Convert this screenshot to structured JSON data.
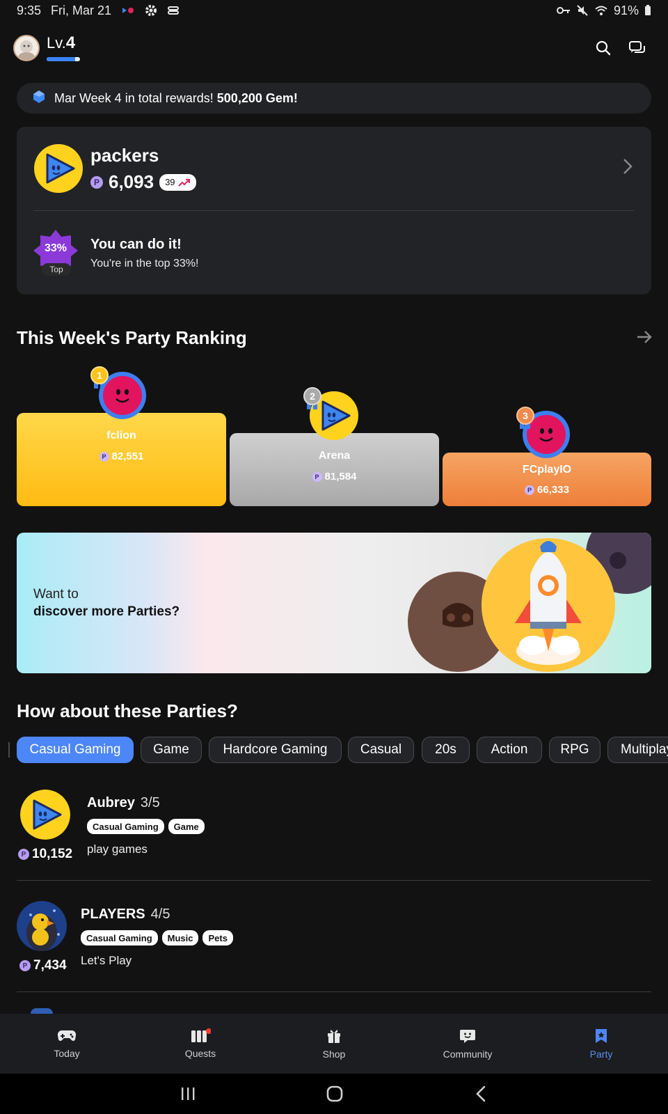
{
  "status_bar": {
    "time": "9:35",
    "date": "Fri, Mar 21",
    "battery": "91%"
  },
  "header": {
    "level_prefix": "Lv.",
    "level": "4",
    "level_progress": 0.85
  },
  "announcement": {
    "text": "Mar Week 4 in total rewards!",
    "highlight": "500,200 Gem!"
  },
  "my_party": {
    "name": "packers",
    "points": "6,093",
    "trend": "39",
    "top_percent": "33%",
    "top_label": "Top",
    "message_title": "You can do it!",
    "message_sub": "You're in the top 33%!"
  },
  "ranking": {
    "title": "This Week's Party Ranking",
    "entries": [
      {
        "rank": "1",
        "name": "fclion",
        "points": "82,551"
      },
      {
        "rank": "2",
        "name": "Arena",
        "points": "81,584"
      },
      {
        "rank": "3",
        "name": "FCplayIO",
        "points": "66,333"
      }
    ]
  },
  "banner": {
    "line1": "Want to",
    "line2": "discover more Parties?"
  },
  "suggestions": {
    "title": "How about these Parties?",
    "chips": [
      "Casual Gaming",
      "Game",
      "Hardcore Gaming",
      "Casual",
      "20s",
      "Action",
      "RPG",
      "Multiplayer"
    ],
    "active_chip": "Casual Gaming",
    "parties": [
      {
        "name": "Aubrey",
        "members": "3/5",
        "tags": [
          "Casual Gaming",
          "Game"
        ],
        "description": "play games",
        "points": "10,152"
      },
      {
        "name": "PLAYERS",
        "members": "4/5",
        "tags": [
          "Casual Gaming",
          "Music",
          "Pets"
        ],
        "description": "Let's Play",
        "points": "7,434"
      }
    ]
  },
  "bottom_nav": {
    "items": [
      {
        "label": "Today",
        "icon": "gamepad-icon"
      },
      {
        "label": "Quests",
        "icon": "quests-icon"
      },
      {
        "label": "Shop",
        "icon": "gift-icon"
      },
      {
        "label": "Community",
        "icon": "chat-smile-icon"
      },
      {
        "label": "Party",
        "icon": "party-flag-icon"
      }
    ],
    "active": "Party"
  },
  "coin_symbol": "P",
  "colors": {
    "accent": "#4d86f7",
    "gold": "#ffc21a",
    "silver": "#b4b4b4",
    "bronze": "#f0854a",
    "background": "#121212"
  }
}
